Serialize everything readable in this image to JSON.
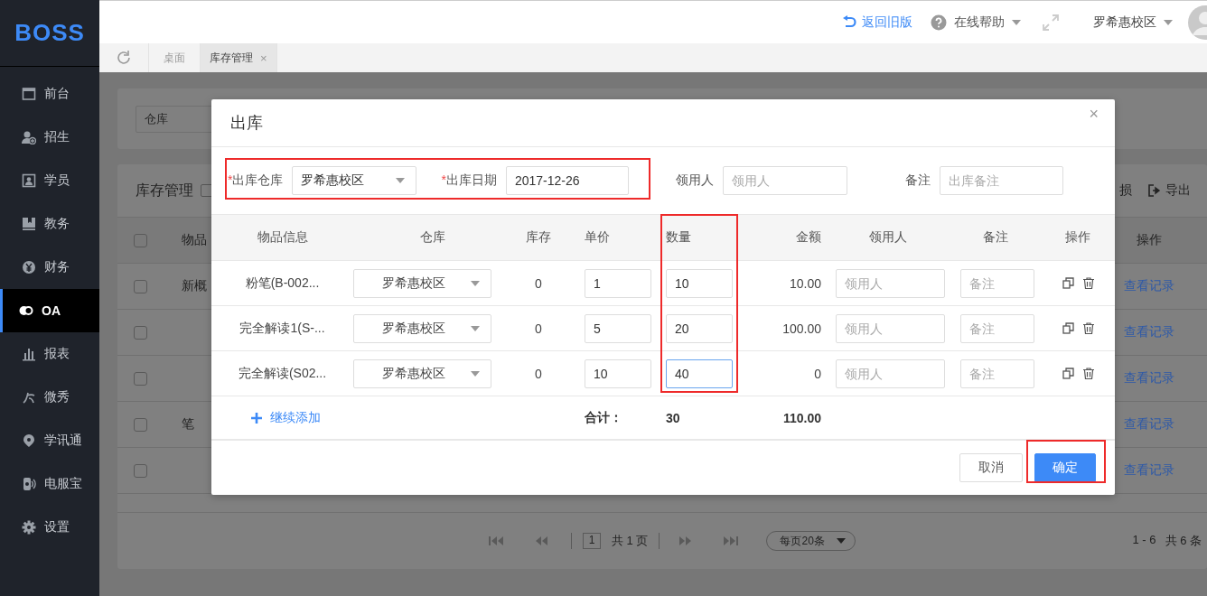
{
  "sidebar": {
    "logo": "BOSS",
    "items": [
      {
        "label": "前台",
        "selected": false
      },
      {
        "label": "招生",
        "selected": false
      },
      {
        "label": "学员",
        "selected": false
      },
      {
        "label": "教务",
        "selected": false
      },
      {
        "label": "财务",
        "selected": false
      },
      {
        "label": "OA",
        "selected": true
      },
      {
        "label": "报表",
        "selected": false
      },
      {
        "label": "微秀",
        "selected": false
      },
      {
        "label": "学讯通",
        "selected": false
      },
      {
        "label": "电服宝",
        "selected": false
      },
      {
        "label": "设置",
        "selected": false
      }
    ]
  },
  "header": {
    "back_link": "返回旧版",
    "help": "在线帮助",
    "campus": "罗希惠校区"
  },
  "tabs": [
    {
      "label": "桌面",
      "selected": false
    },
    {
      "label": "库存管理",
      "selected": true,
      "close": "×"
    }
  ],
  "background": {
    "filter_value": "仓库",
    "card_title": "库存管理",
    "card_checked": false,
    "header_checked": false,
    "toolbar": [
      "损",
      "导出"
    ],
    "columns": [
      "物品",
      "操作"
    ],
    "rows": [
      {
        "item": "新概",
        "action": "查看记录",
        "checked": false
      },
      {
        "action": "查看记录",
        "checked": false
      },
      {
        "action": "查看记录",
        "checked": false
      },
      {
        "item": "笔",
        "action": "查看记录",
        "checked": false
      },
      {
        "action": "查看记录",
        "checked": false
      }
    ],
    "pagination": {
      "page": "1",
      "pages": "共 1 页",
      "page_size": "每页20条",
      "range": "1 - 6",
      "total": "共 6 条"
    }
  },
  "modal": {
    "title": "出库",
    "close": "×",
    "form": [
      {
        "required_mark": "*",
        "label": "出库仓库",
        "kind": "select",
        "value": "罗希惠校区"
      },
      {
        "required_mark": "*",
        "label": "出库日期",
        "kind": "input",
        "value": "2017-12-26"
      },
      {
        "label": "领用人",
        "kind": "input",
        "placeholder": "领用人"
      },
      {
        "label": "备注",
        "kind": "input",
        "placeholder": "出库备注"
      }
    ],
    "columns": [
      "物品信息",
      "仓库",
      "库存",
      "单价",
      "数量",
      "金额",
      "领用人",
      "备注",
      "操作"
    ],
    "rows": [
      {
        "item": "粉笔(B-002...",
        "warehouse": "罗希惠校区",
        "stock": "0",
        "price": "1",
        "qty": "10",
        "qty_focused": false,
        "amount": "10.00",
        "receiver_placeholder": "领用人",
        "note_placeholder": "备注"
      },
      {
        "item": "完全解读1(S-...",
        "warehouse": "罗希惠校区",
        "stock": "0",
        "price": "5",
        "qty": "20",
        "qty_focused": false,
        "amount": "100.00",
        "receiver_placeholder": "领用人",
        "note_placeholder": "备注"
      },
      {
        "item": "完全解读(S02...",
        "warehouse": "罗希惠校区",
        "stock": "0",
        "price": "10",
        "qty": "40",
        "qty_focused": true,
        "amount": "0",
        "receiver_placeholder": "领用人",
        "note_placeholder": "备注"
      }
    ],
    "add": "继续添加",
    "total_label": "合计：",
    "total_qty": "30",
    "total_amount": "110.00",
    "buttons": [
      {
        "label": "取消",
        "kind": "default"
      },
      {
        "label": "确定",
        "kind": "primary"
      }
    ]
  }
}
